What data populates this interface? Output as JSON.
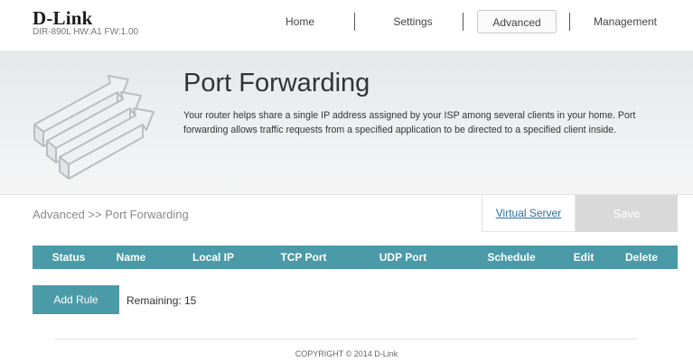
{
  "header": {
    "logo_text": "D-Link",
    "hw_text": "DIR-890L  HW:A1  FW:1.00"
  },
  "nav": {
    "home": "Home",
    "settings": "Settings",
    "advanced": "Advanced",
    "management": "Management",
    "active": "Advanced"
  },
  "hero": {
    "title": "Port Forwarding",
    "description": "Your router helps share a single IP address assigned by your ISP among several clients in your home. Port forwarding allows traffic requests from a specified application to be directed to a specified client inside.",
    "icon": "port-forwarding-arrows-icon"
  },
  "breadcrumb": "Advanced >> Port Forwarding",
  "actions": {
    "virtual_server": "Virtual Server",
    "save": "Save"
  },
  "table": {
    "headers": [
      "Status",
      "Name",
      "Local IP",
      "TCP Port",
      "UDP Port",
      "Schedule",
      "Edit",
      "Delete"
    ],
    "rows": []
  },
  "rules": {
    "add_label": "Add Rule",
    "remaining_label": "Remaining:",
    "remaining_value": "15"
  },
  "footer": {
    "copyright": "COPYRIGHT © 2014 D-Link"
  },
  "colors": {
    "accent": "#4a9aa8",
    "save_disabled": "#d9d9d9",
    "link": "#2c6f9e"
  }
}
